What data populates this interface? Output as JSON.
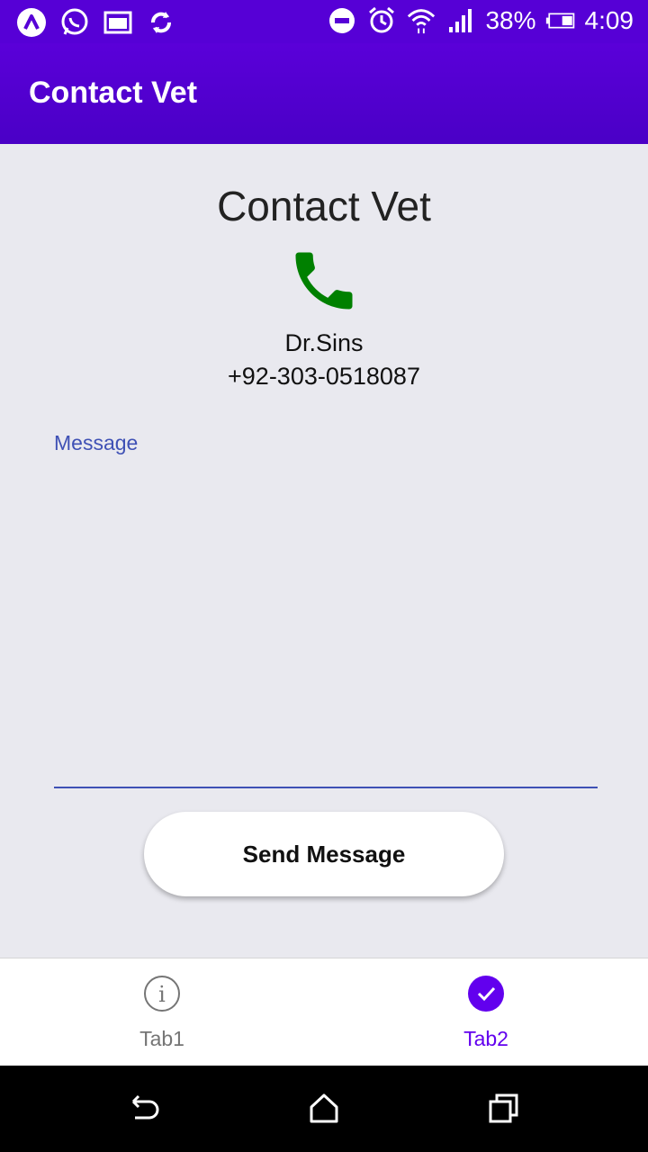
{
  "status_bar": {
    "battery_percent": "38%",
    "time": "4:09",
    "left_icons": [
      "app-logo-icon",
      "whatsapp-icon",
      "gallery-icon",
      "sync-icon"
    ],
    "right_icons": [
      "do-not-disturb-icon",
      "alarm-icon",
      "wifi-icon",
      "signal-icon",
      "battery-icon"
    ]
  },
  "app_bar": {
    "title": "Contact Vet"
  },
  "main": {
    "heading": "Contact Vet",
    "phone_icon": "phone-icon",
    "vet_name": "Dr.Sins",
    "vet_phone": "+92-303-0518087",
    "message_label": "Message",
    "message_value": "",
    "send_button_label": "Send Message"
  },
  "tabs": [
    {
      "label": "Tab1",
      "icon": "info-icon",
      "selected": false
    },
    {
      "label": "Tab2",
      "icon": "check-circle-icon",
      "selected": true
    }
  ],
  "nav_bar": {
    "icons": [
      "back-icon",
      "home-icon",
      "recents-icon"
    ]
  },
  "colors": {
    "primary": "#5600d6",
    "accent_field": "#3f51b5",
    "phone_green": "#008000",
    "tab_selected": "#6200ee",
    "tab_unselected": "#757575",
    "background": "#e9e9ef"
  }
}
